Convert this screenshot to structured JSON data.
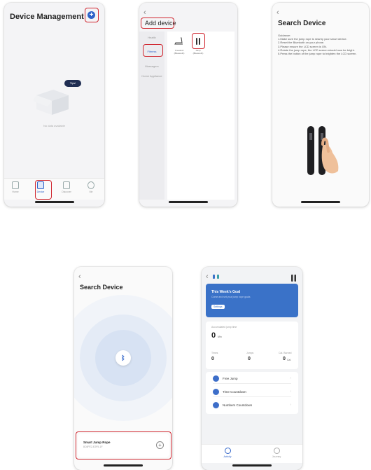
{
  "screen1": {
    "title": "Device Management",
    "empty_text": "No data available",
    "bubble": "Tips!",
    "tabs": [
      {
        "label": "Home"
      },
      {
        "label": "Device"
      },
      {
        "label": "Discover"
      },
      {
        "label": "Me"
      }
    ]
  },
  "screen2": {
    "title": "Add device",
    "categories": [
      "Health",
      "Fitness",
      "Massagers",
      "Home Appliance"
    ],
    "devices": [
      {
        "label": "Treadmill (Bluetooth)"
      },
      {
        "label": "Jump (Bluetooth)"
      }
    ]
  },
  "screen3": {
    "title": "Search Device",
    "guidance": "Guidance:\n1.Make sure the jump rope is nearby your smart device.\n2.Reset the Bluetooth on your phone.\n3.Please ensure the LCD screen is ON.\n4.Rotate the jump rope, the LCD screen should now be bright.\n5.Press the button of the jump rope to brighten the LCD screen."
  },
  "screen4": {
    "title": "Search Device",
    "device_name": "Smart Jump Rope",
    "device_id": "8C6FE2-E2F5-1F"
  },
  "screen5": {
    "goal_title": "This Week's Goal",
    "goal_sub": "Come and set your jump rope goals",
    "settings_label": "Settings",
    "accum_label": "Accumulated jump time",
    "accum_value": "0",
    "accum_unit": "Min",
    "stats": [
      {
        "label": "Times",
        "value": "0"
      },
      {
        "label": "Jumps",
        "value": "0"
      },
      {
        "label": "Cal. Burned",
        "value": "0",
        "unit": "Cal"
      }
    ],
    "modes": [
      "Free Jump",
      "Time Countdown",
      "Numbers Countdown"
    ],
    "tabs": [
      "Activity",
      "Journey"
    ]
  },
  "colors": {
    "highlight": "#d0262f",
    "primary_blue": "#2f63c9",
    "goal_card": "#3a72c8"
  }
}
